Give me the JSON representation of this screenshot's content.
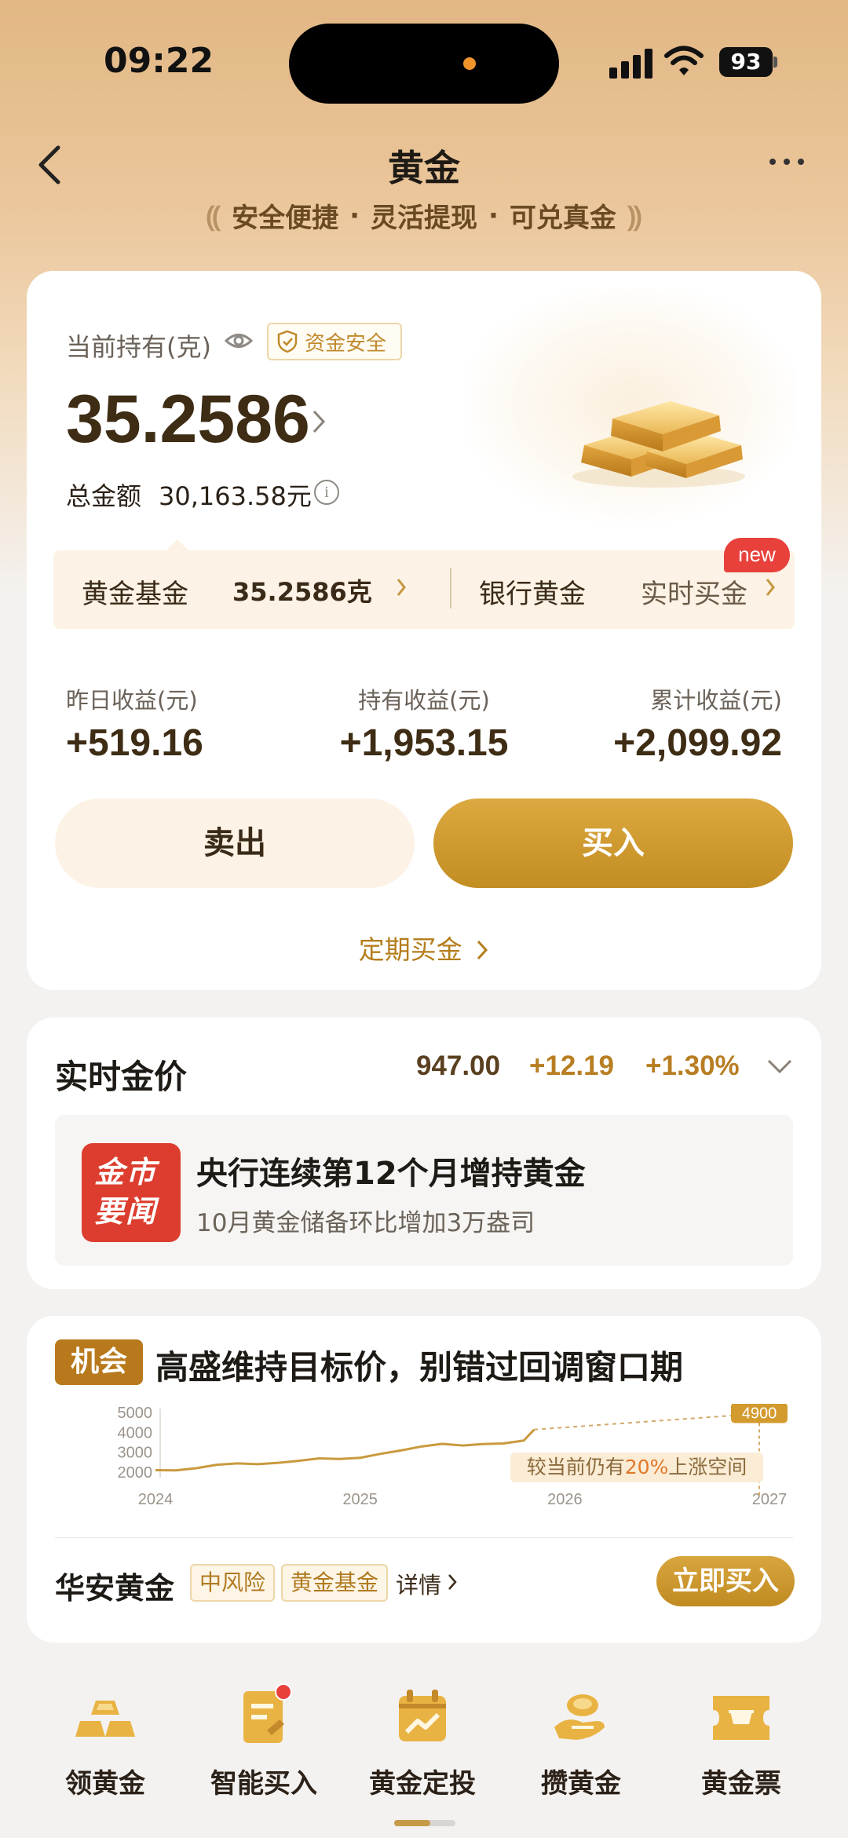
{
  "status_bar": {
    "time": "09:22",
    "battery": "93"
  },
  "header": {
    "title": "黄金",
    "slogan": [
      "安全便捷",
      "灵活提现",
      "可兑真金"
    ]
  },
  "holding": {
    "label": "当前持有(克)",
    "safe_badge": "资金安全",
    "grams": "35.2586",
    "total_label": "总金额",
    "total_value": "30,163.58元"
  },
  "tabs": {
    "fund_label": "黄金基金",
    "fund_value": "35.2586克",
    "bank_label": "银行黄金",
    "realtime_label": "实时买金",
    "new_badge": "new"
  },
  "stats": [
    {
      "label": "昨日收益(元)",
      "value": "+519.16"
    },
    {
      "label": "持有收益(元)",
      "value": "+1,953.15"
    },
    {
      "label": "累计收益(元)",
      "value": "+2,099.92"
    }
  ],
  "actions": {
    "sell": "卖出",
    "buy": "买入",
    "regular_buy": "定期买金"
  },
  "gold_price": {
    "title": "实时金价",
    "price": "947.00",
    "change": "+12.19",
    "change_pct": "+1.30%"
  },
  "news": {
    "logo_line1": "金市",
    "logo_line2": "要闻",
    "title": "央行连续第12个月增持黄金",
    "subtitle": "10月黄金储备环比增加3万盎司"
  },
  "opportunity": {
    "tag": "机会",
    "title": "高盛维持目标价，别错过回调窗口期",
    "callout_prefix": "较当前仍有",
    "callout_pct": "20%",
    "callout_suffix": "上涨空间",
    "fund_name": "华安黄金",
    "risk_tag": "中风险",
    "type_tag": "黄金基金",
    "detail": "详情",
    "buy_now": "立即买入"
  },
  "chart_data": {
    "type": "line",
    "x_ticks": [
      "2024",
      "2025",
      "2026",
      "2027"
    ],
    "y_ticks": [
      "5000",
      "4000",
      "3000",
      "2000"
    ],
    "ylim": [
      2000,
      5000
    ],
    "target_label": "4900",
    "series": [
      {
        "style": "solid",
        "x": [
          2024.0,
          2024.1,
          2024.2,
          2024.3,
          2024.4,
          2024.5,
          2024.6,
          2024.7,
          2024.8,
          2024.9,
          2025.0,
          2025.1,
          2025.2,
          2025.3,
          2025.4,
          2025.5,
          2025.6,
          2025.7,
          2025.8,
          2025.85
        ],
        "y": [
          2060,
          2050,
          2160,
          2330,
          2400,
          2360,
          2430,
          2530,
          2650,
          2620,
          2680,
          2880,
          3050,
          3250,
          3380,
          3300,
          3370,
          3400,
          3550,
          4100
        ]
      },
      {
        "style": "dashed",
        "x": [
          2025.85,
          2026.95
        ],
        "y": [
          4100,
          4900
        ]
      }
    ]
  },
  "bottom_nav": [
    {
      "label": "领黄金",
      "icon": "gold-bars-icon"
    },
    {
      "label": "智能买入",
      "icon": "document-icon"
    },
    {
      "label": "黄金定投",
      "icon": "calendar-chart-icon"
    },
    {
      "label": "攒黄金",
      "icon": "hand-coin-icon"
    },
    {
      "label": "黄金票",
      "icon": "ticket-icon"
    }
  ],
  "colors": {
    "accent": "#c8952c",
    "brand_dark": "#3e2c14",
    "badge_red": "#e8413b"
  }
}
